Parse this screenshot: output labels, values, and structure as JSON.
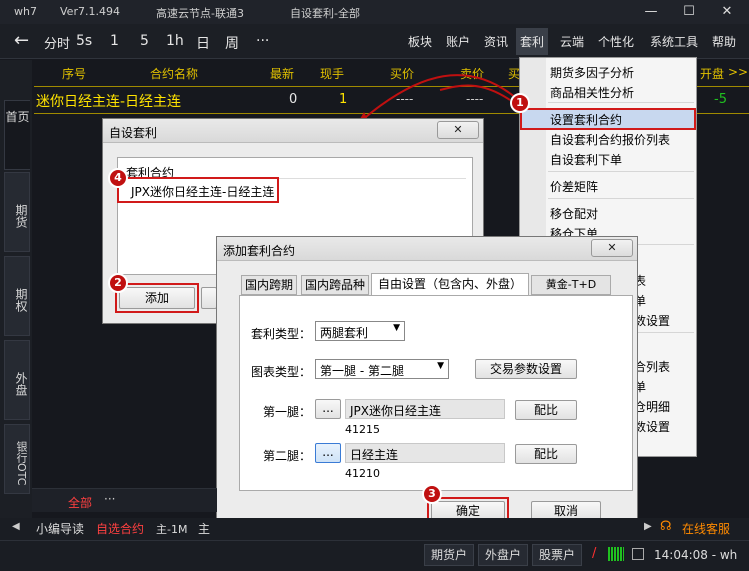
{
  "window": {
    "app": "wh7",
    "version": "Ver7.1.494",
    "server": "高速云节点-联通3",
    "page": "自设套利-全部",
    "controls": {
      "min": "—",
      "max": "☐",
      "close": "✕"
    }
  },
  "toolbar": {
    "back": "←",
    "items": [
      "分时",
      "5s",
      "1",
      "5",
      "1h",
      "日",
      "周",
      "···"
    ],
    "menus": [
      "板块",
      "账户",
      "资讯",
      "套利",
      "云端",
      "个性化",
      "系统工具",
      "帮助"
    ]
  },
  "sidebar": {
    "tabs": [
      "首页",
      "期货",
      "期权",
      "外盘",
      "银行OTC"
    ]
  },
  "table": {
    "columns": [
      "序号",
      "合约名称",
      "最新",
      "现手",
      "买价",
      "卖价",
      "买",
      "开盘"
    ],
    "more": ">>",
    "row": {
      "name": "迷你日经主连-日经主连",
      "latest": "0",
      "volume": "1",
      "bid": "----",
      "ask": "----",
      "open": "-5"
    }
  },
  "dropdown": {
    "items": [
      "期货多因子分析",
      "商品相关性分析",
      "设置套利合约",
      "自设套利合约报价列表",
      "自设套利下单",
      "价差矩阵",
      "移仓配对",
      "移仓下单"
    ],
    "partial": [
      "表",
      "单",
      "数设置",
      "合列表",
      "单",
      "仓明细",
      "数设置"
    ]
  },
  "dialog1": {
    "title": "自设套利",
    "list_header": "套利合约",
    "list_item": "JPX迷你日经主连-日经主连",
    "add_button": "添加",
    "close": "✕"
  },
  "dialog2": {
    "title": "添加套利合约",
    "close": "✕",
    "tabs": [
      "国内跨期",
      "国内跨品种",
      "自由设置（包含内、外盘）",
      "黄金-T+D"
    ],
    "type_label": "套利类型：",
    "type_value": "两腿套利",
    "chart_label": "图表类型：",
    "chart_value": "第一腿 - 第二腿",
    "params_button": "交易参数设置",
    "leg1_label": "第一腿：",
    "leg1_value": "JPX迷你日经主连",
    "leg1_code": "41215",
    "leg2_label": "第二腿：",
    "leg2_value": "日经主连",
    "leg2_code": "41210",
    "browse": "...",
    "ratio_button": "配比",
    "ok": "确定",
    "cancel": "取消"
  },
  "badges": [
    "1",
    "2",
    "3",
    "4"
  ],
  "bottom": {
    "tab_all": "全部",
    "tab_more": "···",
    "nav_left": "◀",
    "nav_tabs": [
      "小编导读",
      "自选合约",
      "主-1M",
      "主"
    ],
    "nav_right": "▶",
    "service": "在线客服",
    "status_buttons": [
      "期货户",
      "外盘户",
      "股票户"
    ],
    "slash": "/",
    "time": "14:04:08 - wh"
  },
  "colors": {
    "accent": "#e0c000",
    "badge": "#c01010",
    "highlight": "#c8d8ef",
    "selected": "#ff4040"
  }
}
